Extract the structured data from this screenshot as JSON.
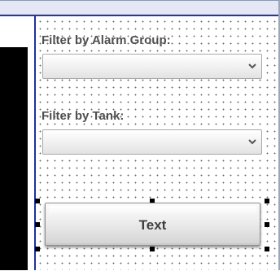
{
  "filters": {
    "alarm_group_label": "Filter by Alarm Group:",
    "tank_label": "Filter by Tank:"
  },
  "button": {
    "label": "Text"
  },
  "icons": {
    "select_arrow": "chevron-down-icon"
  },
  "colors": {
    "frame_border": "#1f2f9b",
    "selection_handle": "#000000",
    "background": "#ffffff"
  }
}
